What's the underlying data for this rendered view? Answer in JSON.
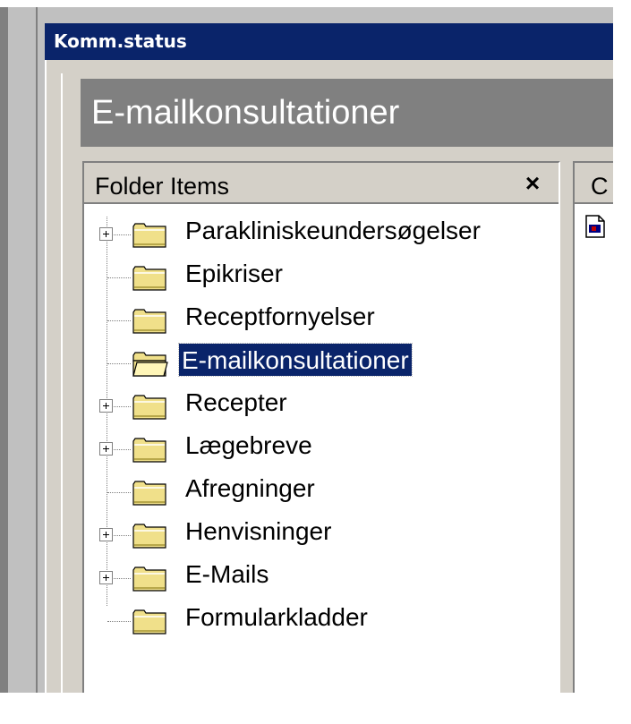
{
  "window": {
    "title": "Komm.status"
  },
  "header": {
    "title": "E-mailkonsultationer"
  },
  "folder_panel": {
    "title": "Folder Items",
    "close_label": "×",
    "items": [
      {
        "label": "Parakliniskeundersøgelser",
        "expandable": true,
        "selected": false
      },
      {
        "label": "Epikriser",
        "expandable": false,
        "selected": false
      },
      {
        "label": "Receptfornyelser",
        "expandable": false,
        "selected": false
      },
      {
        "label": "E-mailkonsultationer",
        "expandable": false,
        "selected": true
      },
      {
        "label": "Recepter",
        "expandable": true,
        "selected": false
      },
      {
        "label": "Lægebreve",
        "expandable": true,
        "selected": false
      },
      {
        "label": "Afregninger",
        "expandable": false,
        "selected": false
      },
      {
        "label": "Henvisninger",
        "expandable": true,
        "selected": false
      },
      {
        "label": "E-Mails",
        "expandable": true,
        "selected": false
      },
      {
        "label": "Formularkladder",
        "expandable": false,
        "selected": false
      }
    ]
  },
  "content_panel": {
    "header_label": "C"
  },
  "colors": {
    "titlebar": "#0a246a",
    "selection": "#0a246a",
    "banner": "#808080",
    "folder": "#f0e08a"
  }
}
